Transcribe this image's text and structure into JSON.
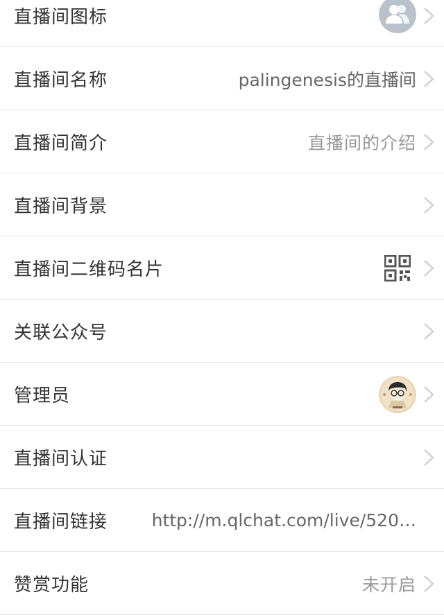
{
  "rows": [
    {
      "label": "直播间图标",
      "value": "",
      "kind": "avatar-default"
    },
    {
      "label": "直播间名称",
      "value": "palingenesis的直播间",
      "kind": "text"
    },
    {
      "label": "直播间简介",
      "value": "直播间的介绍",
      "kind": "text"
    },
    {
      "label": "直播间背景",
      "value": "",
      "kind": "none"
    },
    {
      "label": "直播间二维码名片",
      "value": "",
      "kind": "qr"
    },
    {
      "label": "关联公众号",
      "value": "",
      "kind": "none"
    },
    {
      "label": "管理员",
      "value": "",
      "kind": "admin-avatar"
    },
    {
      "label": "直播间认证",
      "value": "",
      "kind": "none"
    },
    {
      "label": "直播间链接",
      "value": "http://m.qlchat.com/live/520…",
      "kind": "link"
    },
    {
      "label": "赞赏功能",
      "value": "未开启",
      "kind": "text"
    }
  ],
  "colors": {
    "label": "#333333",
    "value": "#999999",
    "divider": "#e5e5e5",
    "chevron": "#c8c8c8",
    "avatar_bg": "#b9c2ca"
  },
  "icons": {
    "chevron": "chevron-right-icon",
    "default_avatar": "user-group-icon",
    "qr": "qr-code-icon",
    "admin": "admin-avatar-icon"
  }
}
